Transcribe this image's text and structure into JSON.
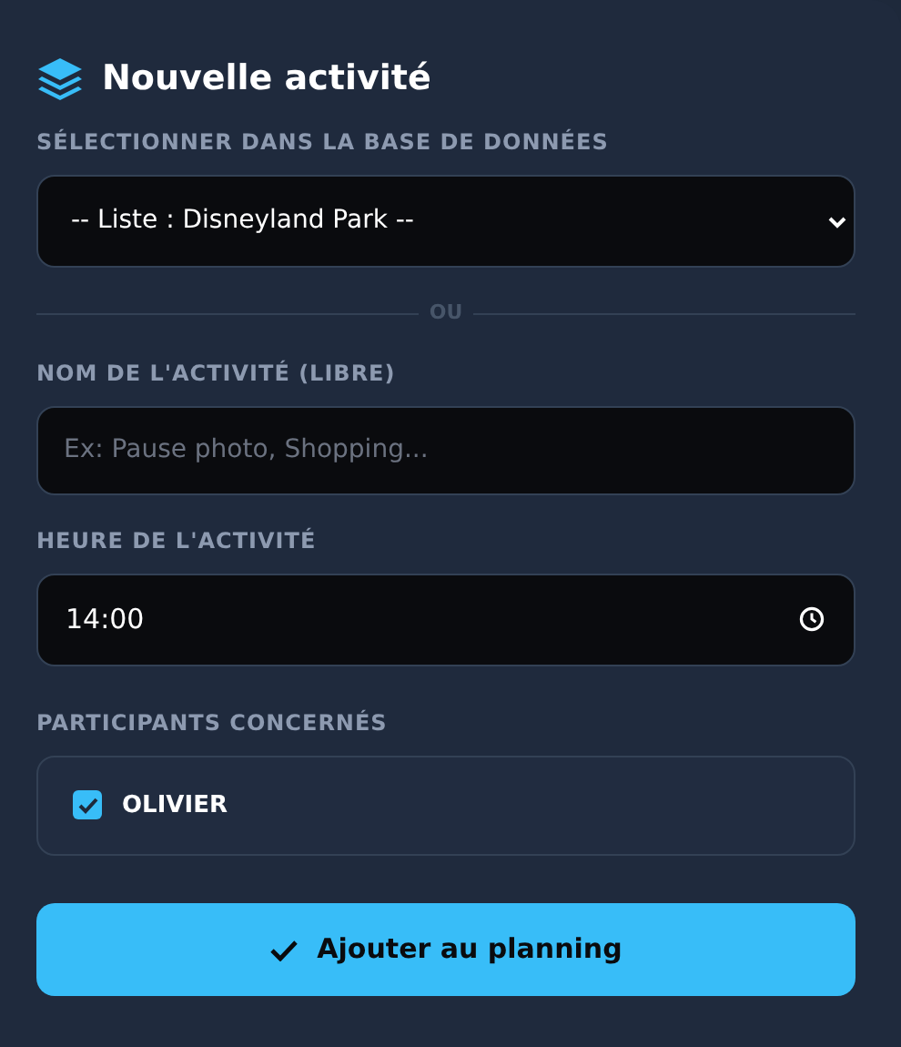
{
  "title": "Nouvelle activité",
  "database": {
    "label": "SÉLECTIONNER DANS LA BASE DE DONNÉES",
    "value": "-- Liste : Disneyland Park --"
  },
  "separator": "OU",
  "name_field": {
    "label": "NOM DE L'ACTIVITÉ (LIBRE)",
    "placeholder": "Ex: Pause photo, Shopping..."
  },
  "time_field": {
    "label": "HEURE DE L'ACTIVITÉ",
    "value": "14:00"
  },
  "participants": {
    "label": "PARTICIPANTS CONCERNÉS",
    "items": [
      {
        "name": "OLIVIER",
        "checked": true
      }
    ]
  },
  "submit": "Ajouter au planning"
}
